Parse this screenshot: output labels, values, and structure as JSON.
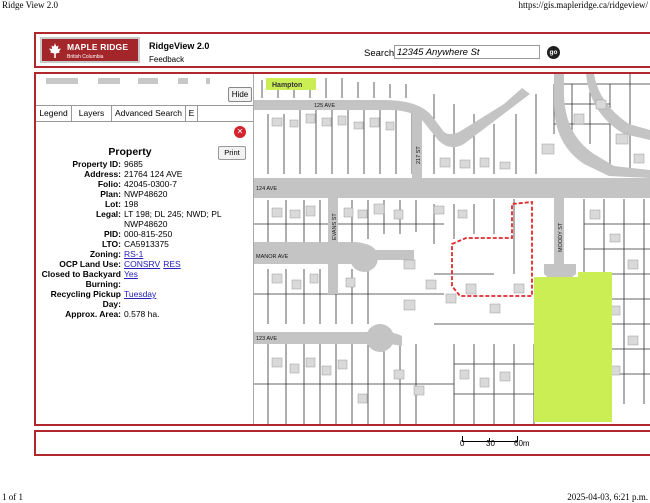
{
  "print_header": {
    "title": "Ridge View 2.0",
    "url": "https://gis.mapleridge.ca/ridgeview/"
  },
  "print_footer": {
    "pages": "1 of 1",
    "timestamp": "2025-04-03, 6:21 p.m."
  },
  "header": {
    "logo_name": "MAPLE RIDGE",
    "logo_sub": "British Columbia",
    "logo_icon": "maple-leaf-icon",
    "app_title": "RidgeView 2.0",
    "feedback_label": "Feedback",
    "search_label": "Search:",
    "search_value": "12345 Anywhere St",
    "go_label": "go"
  },
  "panel": {
    "hide_label": "Hide",
    "tabs": [
      "Legend",
      "Layers",
      "Advanced Search",
      "E"
    ],
    "print_label": "Print",
    "close_icon": "close-icon",
    "property": {
      "title": "Property",
      "rows": [
        {
          "label": "Property ID:",
          "value": "9685"
        },
        {
          "label": "Address:",
          "value": "21764 124 AVE"
        },
        {
          "label": "Folio:",
          "value": "42045-0300-7"
        },
        {
          "label": "Plan:",
          "value": "NWP48620"
        },
        {
          "label": "Lot:",
          "value": "198"
        },
        {
          "label": "Legal:",
          "value": "LT 198; DL 245; NWD; PL NWP48620"
        },
        {
          "label": "PID:",
          "value": "000-815-250"
        },
        {
          "label": "LTO:",
          "value": "CA5913375"
        },
        {
          "label": "Zoning:",
          "links": [
            "RS-1"
          ]
        },
        {
          "label": "OCP Land Use:",
          "links": [
            "CONSRV",
            "RES"
          ]
        },
        {
          "label": "Closed to Backyard Burning:",
          "links": [
            "Yes"
          ]
        },
        {
          "label": "Recycling Pickup Day:",
          "links": [
            "Tuesday"
          ]
        },
        {
          "label": "Approx. Area:",
          "value": "0.578 ha."
        }
      ]
    }
  },
  "map": {
    "road_labels": {
      "hampton": "Hampton",
      "ave125": "125 AVE",
      "st217": "217 ST",
      "ave124": "124 AVE",
      "evans": "EVANS ST",
      "manor": "MANOR AVE",
      "moody": "MOODY ST",
      "ave123": "123 AVE"
    },
    "colors": {
      "road": "#c4c4c4",
      "building": "#d9d9d9",
      "highlight_fill": "#ccee55",
      "hampton_fill": "#ccee55",
      "selection_outline": "#e0282c",
      "parcel_line": "#333333"
    }
  },
  "scale": {
    "labels": [
      "0",
      "30",
      "60m"
    ]
  }
}
